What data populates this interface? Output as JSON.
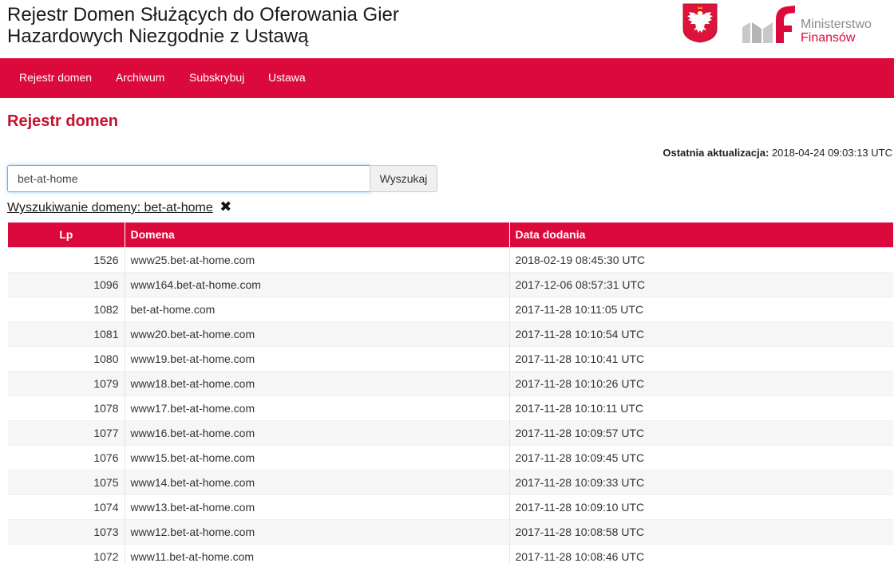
{
  "header": {
    "title_line1": "Rejestr Domen Służących do Oferowania Gier",
    "title_line2": "Hazardowych Niezgodnie z Ustawą",
    "ministry_line1": "Ministerstwo",
    "ministry_line2": "Finansów",
    "brand_color": "#dc0a3c",
    "icons": [
      "polish-eagle-emblem-icon",
      "mf-logo-icon"
    ]
  },
  "nav": {
    "items": [
      {
        "label": "Rejestr domen"
      },
      {
        "label": "Archiwum"
      },
      {
        "label": "Subskrybuj"
      },
      {
        "label": "Ustawa"
      }
    ]
  },
  "main": {
    "heading": "Rejestr domen",
    "last_update_label": "Ostatnia aktualizacja:",
    "last_update_value": "2018-04-24 09:03:13 UTC",
    "search": {
      "value": "bet-at-home",
      "button_label": "Wyszukaj"
    },
    "filter": {
      "label": "Wyszukiwanie domeny: bet-at-home",
      "clear_icon": "close-icon"
    },
    "table": {
      "columns": [
        "Lp",
        "Domena",
        "Data dodania"
      ],
      "rows": [
        {
          "lp": "1526",
          "domain": "www25.bet-at-home.com",
          "date": "2018-02-19 08:45:30 UTC"
        },
        {
          "lp": "1096",
          "domain": "www164.bet-at-home.com",
          "date": "2017-12-06 08:57:31 UTC"
        },
        {
          "lp": "1082",
          "domain": "bet-at-home.com",
          "date": "2017-11-28 10:11:05 UTC"
        },
        {
          "lp": "1081",
          "domain": "www20.bet-at-home.com",
          "date": "2017-11-28 10:10:54 UTC"
        },
        {
          "lp": "1080",
          "domain": "www19.bet-at-home.com",
          "date": "2017-11-28 10:10:41 UTC"
        },
        {
          "lp": "1079",
          "domain": "www18.bet-at-home.com",
          "date": "2017-11-28 10:10:26 UTC"
        },
        {
          "lp": "1078",
          "domain": "www17.bet-at-home.com",
          "date": "2017-11-28 10:10:11 UTC"
        },
        {
          "lp": "1077",
          "domain": "www16.bet-at-home.com",
          "date": "2017-11-28 10:09:57 UTC"
        },
        {
          "lp": "1076",
          "domain": "www15.bet-at-home.com",
          "date": "2017-11-28 10:09:45 UTC"
        },
        {
          "lp": "1075",
          "domain": "www14.bet-at-home.com",
          "date": "2017-11-28 10:09:33 UTC"
        },
        {
          "lp": "1074",
          "domain": "www13.bet-at-home.com",
          "date": "2017-11-28 10:09:10 UTC"
        },
        {
          "lp": "1073",
          "domain": "www12.bet-at-home.com",
          "date": "2017-11-28 10:08:58 UTC"
        },
        {
          "lp": "1072",
          "domain": "www11.bet-at-home.com",
          "date": "2017-11-28 10:08:46 UTC"
        }
      ]
    }
  }
}
